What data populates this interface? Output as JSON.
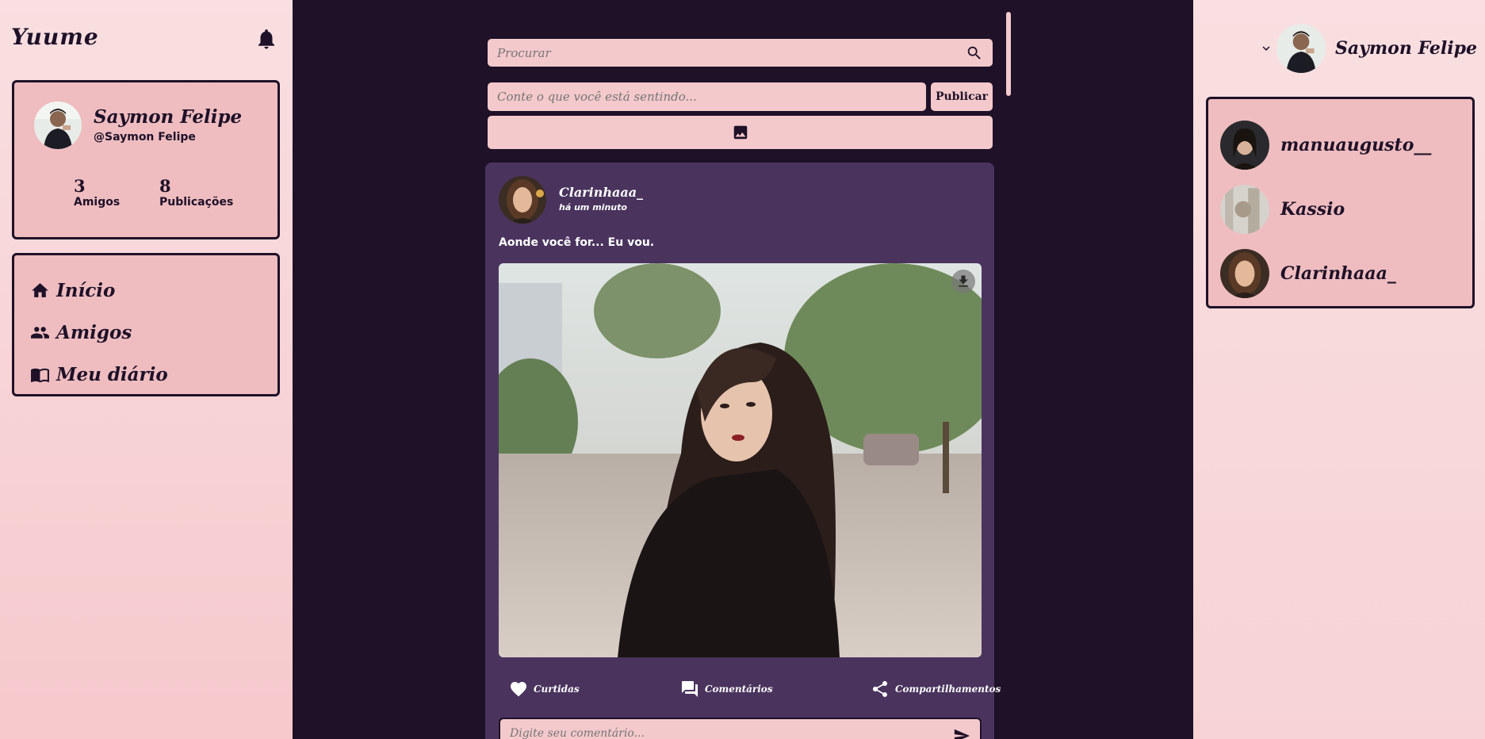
{
  "app": {
    "logo": "Yuume"
  },
  "profile": {
    "name": "Saymon Felipe",
    "handle": "@Saymon Felipe",
    "stats": [
      {
        "value": "3",
        "label": "Amigos"
      },
      {
        "value": "8",
        "label": "Publicações"
      }
    ]
  },
  "menu": {
    "items": [
      {
        "label": "Início",
        "icon": "home-icon"
      },
      {
        "label": "Amigos",
        "icon": "people-icon"
      },
      {
        "label": "Meu diário",
        "icon": "book-icon"
      }
    ]
  },
  "search": {
    "placeholder": "Procurar"
  },
  "composer": {
    "placeholder": "Conte o que você está sentindo...",
    "publish_label": "Publicar"
  },
  "post": {
    "user": "Clarinhaaa_",
    "time": "há um minuto",
    "text": "Aonde você for... Eu vou.",
    "actions": {
      "likes": "Curtidas",
      "comments": "Comentários",
      "shares": "Compartilhamentos"
    },
    "comment_placeholder": "Digite seu comentário..."
  },
  "header_user": {
    "name": "Saymon Felipe"
  },
  "friends": {
    "items": [
      {
        "name": "manuaugusto__"
      },
      {
        "name": "Kassio"
      },
      {
        "name": "Clarinhaaa_"
      }
    ]
  },
  "colors": {
    "background_dark": "#1e1128",
    "panel_pink": "#efbdc0",
    "input_pink": "#f4c9cb",
    "post_purple": "#4a345e"
  }
}
